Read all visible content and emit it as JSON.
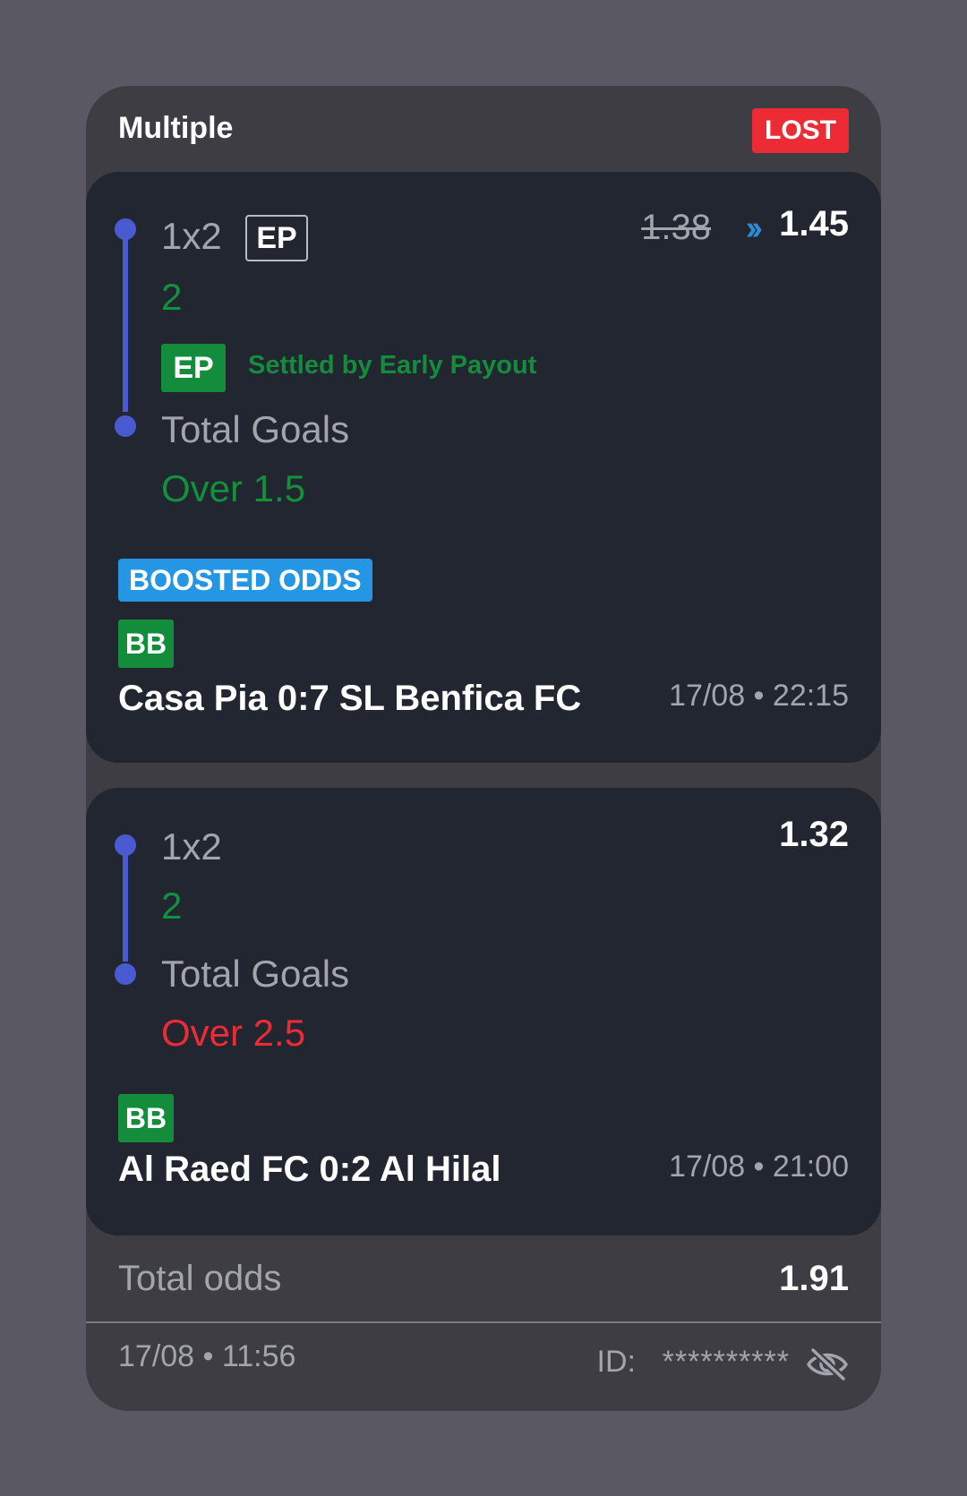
{
  "ticket": {
    "title": "Multiple",
    "status": "LOST",
    "status_color": "#ec2b35"
  },
  "bets": [
    {
      "legs": [
        {
          "market": "1x2",
          "market_tag": "EP",
          "selection": "2",
          "selection_status": "won",
          "ep_badge": "EP",
          "ep_note": "Settled by Early Payout"
        },
        {
          "market": "Total Goals",
          "selection": "Over 1.5",
          "selection_status": "won"
        }
      ],
      "odds_old": "1.38",
      "odds": "1.45",
      "boost_badge": "BOOSTED ODDS",
      "bb_badge": "BB",
      "match": "Casa Pia 0:7 SL Benfica FC",
      "time": "17/08 • 22:15"
    },
    {
      "legs": [
        {
          "market": "1x2",
          "selection": "2",
          "selection_status": "won"
        },
        {
          "market": "Total Goals",
          "selection": "Over 2.5",
          "selection_status": "lost"
        }
      ],
      "odds": "1.32",
      "bb_badge": "BB",
      "match": "Al Raed FC 0:2 Al Hilal",
      "time": "17/08 • 21:00"
    }
  ],
  "footer": {
    "total_label": "Total odds",
    "total_value": "1.91",
    "placed_time": "17/08 • 11:56",
    "id_label": "ID:",
    "id_value": "**********",
    "visibility_icon": "eye-off-icon"
  },
  "colors": {
    "won": "#138c3b",
    "lost": "#ec2b35",
    "boost": "#2596e4",
    "timeline": "#4a5bd1"
  }
}
